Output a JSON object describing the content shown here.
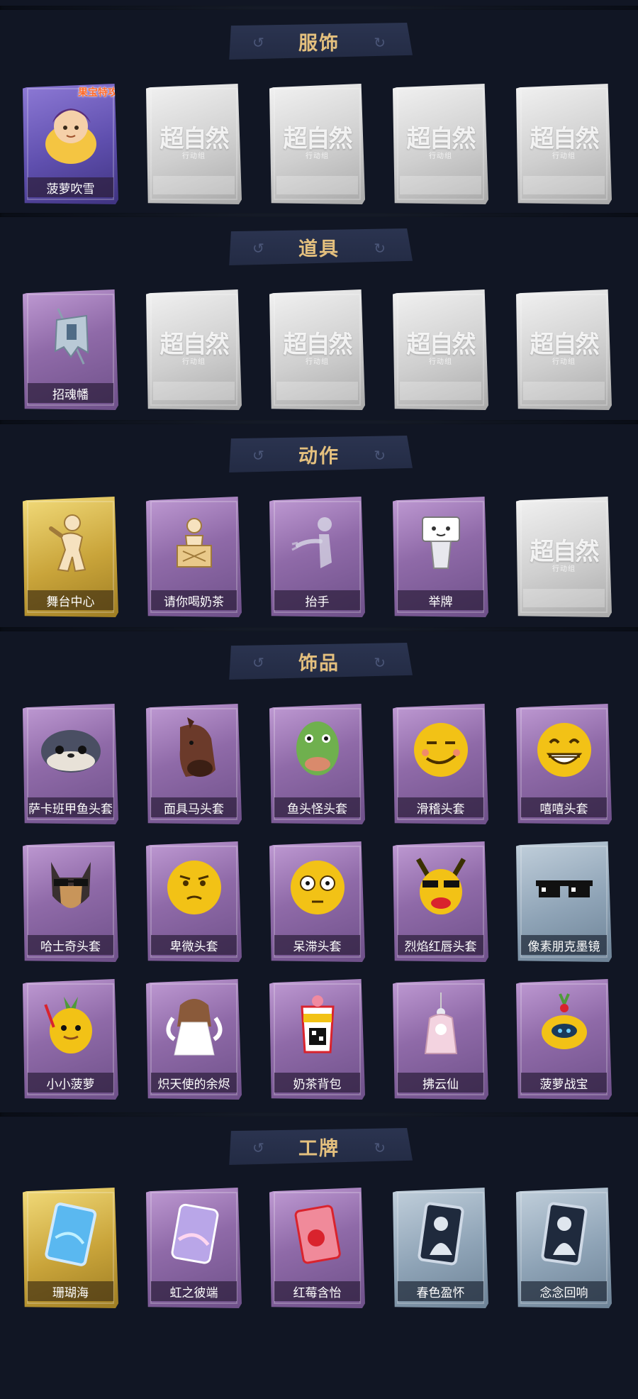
{
  "placeholder": {
    "mark": "超自然",
    "sub": "行动组"
  },
  "sections": [
    {
      "title": "服饰",
      "items": [
        {
          "label": "菠萝吹雪",
          "tone": "violet",
          "icon": "character-portrait-icon",
          "badge": "果宝特攻"
        },
        {
          "label": "",
          "tone": "gray",
          "icon": "placeholder"
        },
        {
          "label": "",
          "tone": "gray",
          "icon": "placeholder"
        },
        {
          "label": "",
          "tone": "gray",
          "icon": "placeholder"
        },
        {
          "label": "",
          "tone": "gray",
          "icon": "placeholder"
        }
      ]
    },
    {
      "title": "道具",
      "items": [
        {
          "label": "招魂幡",
          "tone": "purple",
          "icon": "banner-icon"
        },
        {
          "label": "",
          "tone": "gray",
          "icon": "placeholder"
        },
        {
          "label": "",
          "tone": "gray",
          "icon": "placeholder"
        },
        {
          "label": "",
          "tone": "gray",
          "icon": "placeholder"
        },
        {
          "label": "",
          "tone": "gray",
          "icon": "placeholder"
        }
      ]
    },
    {
      "title": "动作",
      "items": [
        {
          "label": "舞台中心",
          "tone": "gold",
          "icon": "pose-figure-icon"
        },
        {
          "label": "请你喝奶茶",
          "tone": "purple",
          "icon": "figure-holding-sign-icon"
        },
        {
          "label": "抬手",
          "tone": "purple",
          "icon": "raise-hand-icon"
        },
        {
          "label": "举牌",
          "tone": "purple",
          "icon": "hold-sign-icon"
        },
        {
          "label": "",
          "tone": "gray",
          "icon": "placeholder"
        }
      ]
    },
    {
      "title": "饰品",
      "items": [
        {
          "label": "萨卡班甲鱼头套",
          "tone": "purple",
          "icon": "fish-head-icon"
        },
        {
          "label": "面具马头套",
          "tone": "purple",
          "icon": "horse-head-icon"
        },
        {
          "label": "鱼头怪头套",
          "tone": "purple",
          "icon": "green-fish-head-icon"
        },
        {
          "label": "滑稽头套",
          "tone": "purple",
          "icon": "funny-face-icon"
        },
        {
          "label": "嘻嘻头套",
          "tone": "purple",
          "icon": "grin-face-icon"
        },
        {
          "label": "哈士奇头套",
          "tone": "purple",
          "icon": "husky-head-icon"
        },
        {
          "label": "卑微头套",
          "tone": "purple",
          "icon": "humble-face-icon"
        },
        {
          "label": "呆滞头套",
          "tone": "purple",
          "icon": "dazed-face-icon"
        },
        {
          "label": "烈焰红唇头套",
          "tone": "purple",
          "icon": "red-lips-head-icon"
        },
        {
          "label": "像素朋克墨镜",
          "tone": "blue",
          "icon": "pixel-sunglasses-icon"
        },
        {
          "label": "小小菠萝",
          "tone": "purple",
          "icon": "pineapple-doll-icon"
        },
        {
          "label": "炽天使的余烬",
          "tone": "purple",
          "icon": "angel-doll-icon"
        },
        {
          "label": "奶茶背包",
          "tone": "purple",
          "icon": "milk-tea-bag-icon"
        },
        {
          "label": "拂云仙",
          "tone": "purple",
          "icon": "cloud-fairy-charm-icon"
        },
        {
          "label": "菠萝战宝",
          "tone": "purple",
          "icon": "pineapple-robot-icon"
        }
      ]
    },
    {
      "title": "工牌",
      "items": [
        {
          "label": "珊瑚海",
          "tone": "gold",
          "icon": "coral-sea-card-icon"
        },
        {
          "label": "虹之彼端",
          "tone": "purple",
          "icon": "rainbow-card-icon"
        },
        {
          "label": "红莓含怡",
          "tone": "purple",
          "icon": "raspberry-card-icon"
        },
        {
          "label": "春色盈怀",
          "tone": "blue",
          "icon": "silhouette-card-icon"
        },
        {
          "label": "念念回响",
          "tone": "blue",
          "icon": "silhouette-card-icon"
        }
      ]
    }
  ],
  "colors": {
    "background": "#111624",
    "header_text": "#e4c07e",
    "purple": "#9c7ab8",
    "gold": "#d4af3f",
    "gray": "#cccccc",
    "blue": "#8ea3b6"
  }
}
